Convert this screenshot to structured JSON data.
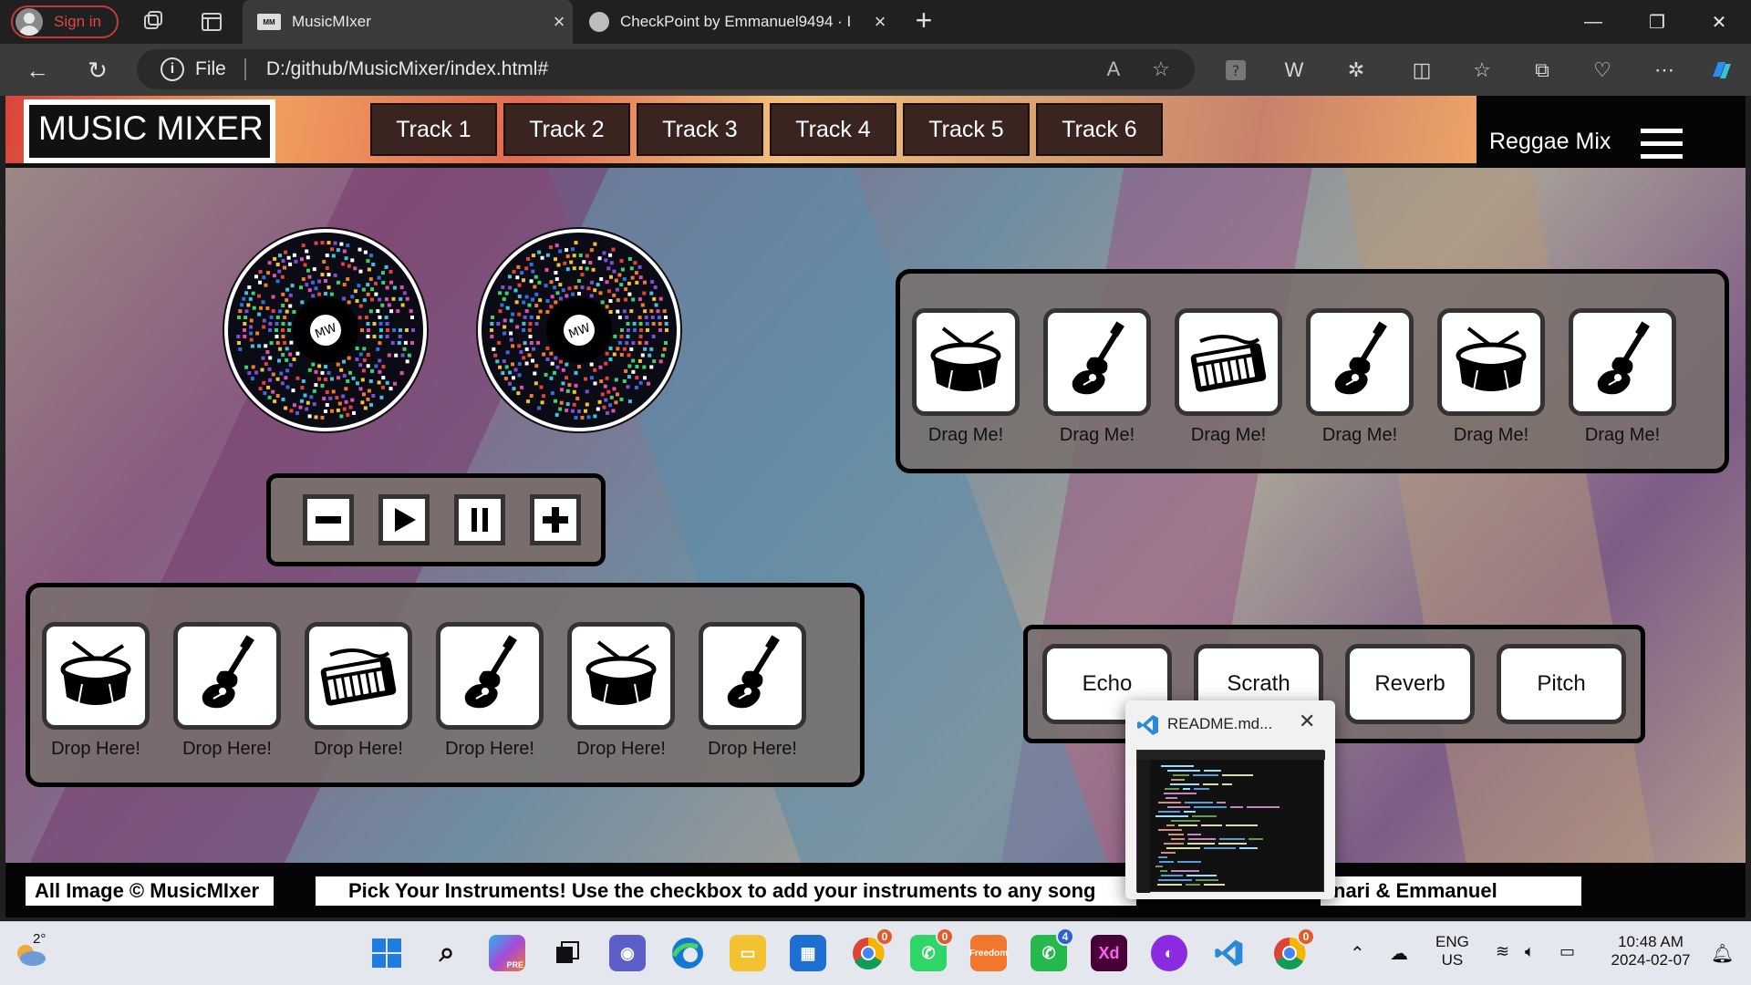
{
  "browser": {
    "signin_label": "Sign in",
    "tabs": [
      {
        "title": "MusicMIxer",
        "favicon": "MM"
      },
      {
        "title": "CheckPoint by Emmanuel9494 · I"
      }
    ],
    "address": {
      "scheme_label": "File",
      "url": "D:/github/MusicMixer/index.html#"
    }
  },
  "header": {
    "logo": "MUSIC MIXER",
    "tracks": [
      "Track 1",
      "Track 2",
      "Track 3",
      "Track 4",
      "Track 5",
      "Track 6"
    ],
    "mix_label": "Reggae Mix"
  },
  "vinyls": [
    {
      "label": "MW"
    },
    {
      "label": "MW"
    }
  ],
  "controls": {
    "buttons": [
      {
        "icon": "minus-icon",
        "glyph": "−"
      },
      {
        "icon": "play-icon",
        "glyph": "▶"
      },
      {
        "icon": "pause-icon",
        "glyph": "⏸"
      },
      {
        "icon": "plus-icon",
        "glyph": "+"
      }
    ]
  },
  "drag_panel": {
    "items": [
      {
        "icon": "drum-icon",
        "label": "Drag Me!"
      },
      {
        "icon": "guitar-icon",
        "label": "Drag Me!"
      },
      {
        "icon": "keyboard-icon",
        "label": "Drag Me!"
      },
      {
        "icon": "guitar-icon",
        "label": "Drag Me!"
      },
      {
        "icon": "drum-icon",
        "label": "Drag Me!"
      },
      {
        "icon": "guitar-icon",
        "label": "Drag Me!"
      }
    ]
  },
  "drop_panel": {
    "items": [
      {
        "icon": "drum-icon",
        "label": "Drop Here!"
      },
      {
        "icon": "guitar-icon",
        "label": "Drop Here!"
      },
      {
        "icon": "keyboard-icon",
        "label": "Drop Here!"
      },
      {
        "icon": "guitar-icon",
        "label": "Drop Here!"
      },
      {
        "icon": "drum-icon",
        "label": "Drop Here!"
      },
      {
        "icon": "guitar-icon",
        "label": "Drop Here!"
      }
    ]
  },
  "effects": [
    "Echo",
    "Scrath",
    "Reverb",
    "Pitch"
  ],
  "footer": {
    "copyright": "All Image © MusicMIxer",
    "instructions": "Pick Your Instruments! Use the checkbox to add your instruments to any song",
    "credits": "nari & Emmanuel"
  },
  "popup": {
    "title": "README.md..."
  },
  "taskbar": {
    "weather": "2°",
    "language": "ENG",
    "region": "US",
    "time": "10:48 AM",
    "date": "2024-02-07",
    "badges": {
      "chrome1": "0",
      "whatsapp_beta": "0",
      "whatsapp": "4",
      "chrome2": "0"
    }
  },
  "colors": {
    "accent_red": "#e04545",
    "nav_track_bg": "#3a2420",
    "panel_border": "#000000"
  }
}
